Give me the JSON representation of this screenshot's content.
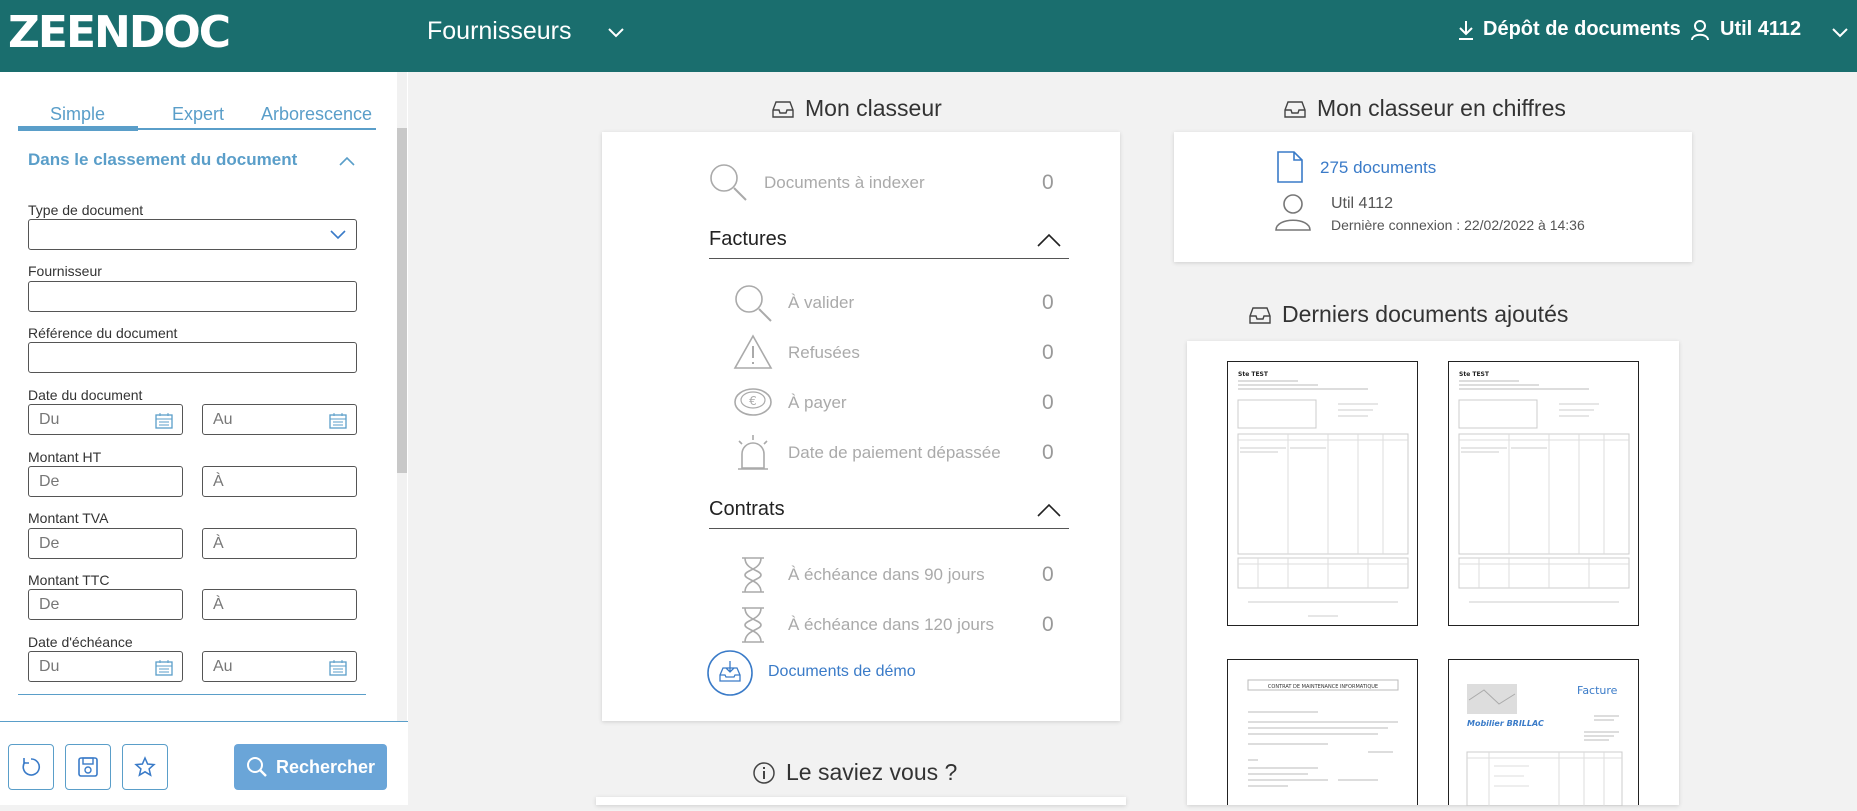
{
  "header": {
    "logo": "ZEENDOC",
    "module": "Fournisseurs",
    "depot_label": "Dépôt de documents",
    "user_label": "Util 4112"
  },
  "sidebar": {
    "tabs": [
      "Simple",
      "Expert",
      "Arborescence"
    ],
    "active_tab": "Simple",
    "section_title": "Dans le classement du document",
    "fields": {
      "type_document": {
        "label": "Type de document",
        "value": ""
      },
      "fournisseur": {
        "label": "Fournisseur",
        "value": ""
      },
      "reference": {
        "label": "Référence du document",
        "value": ""
      },
      "date_document": {
        "label": "Date du document",
        "from_placeholder": "Du",
        "to_placeholder": "Au"
      },
      "montant_ht": {
        "label": "Montant HT",
        "from_placeholder": "De",
        "to_placeholder": "À"
      },
      "montant_tva": {
        "label": "Montant TVA",
        "from_placeholder": "De",
        "to_placeholder": "À"
      },
      "montant_ttc": {
        "label": "Montant TTC",
        "from_placeholder": "De",
        "to_placeholder": "À"
      },
      "date_echeance": {
        "label": "Date d'échéance",
        "from_placeholder": "Du",
        "to_placeholder": "Au"
      }
    },
    "search_label": "Rechercher"
  },
  "classeur": {
    "title": "Mon classeur",
    "a_indexer": {
      "label": "Documents à indexer",
      "count": "0"
    },
    "factures": {
      "title": "Factures",
      "items": [
        {
          "label": "À valider",
          "count": "0",
          "icon": "search-icon"
        },
        {
          "label": "Refusées",
          "count": "0",
          "icon": "warning-icon"
        },
        {
          "label": "À payer",
          "count": "0",
          "icon": "euro-coin-icon"
        },
        {
          "label": "Date de paiement dépassée",
          "count": "0",
          "icon": "alarm-light-icon"
        }
      ]
    },
    "contrats": {
      "title": "Contrats",
      "items": [
        {
          "label": "À échéance dans 90 jours",
          "count": "0",
          "icon": "hourglass-icon"
        },
        {
          "label": "À échéance dans 120 jours",
          "count": "0",
          "icon": "hourglass-icon"
        }
      ]
    },
    "demo_label": "Documents de démo"
  },
  "chiffres": {
    "title": "Mon classeur en chiffres",
    "documents_label": "275 documents",
    "user_name": "Util 4112",
    "last_login": "Dernière connexion : 22/02/2022 à 14:36"
  },
  "derniers": {
    "title": "Derniers documents ajoutés",
    "thumbs": [
      "facture-test-1",
      "facture-test-2",
      "contrat-maintenance",
      "facture-mobilier-brillac"
    ],
    "thumb_texts": {
      "test_title": "Ste TEST",
      "contrat_title": "CONTRAT DE MAINTENANCE INFORMATIQUE",
      "facture_label": "Facture",
      "mobilier_label": "Mobilier BRILLAC"
    }
  },
  "saviez_vous": {
    "title": "Le saviez vous ?"
  },
  "colors": {
    "header_bg": "#1a6e6e",
    "accent": "#5a9ec9",
    "link": "#3a7bc8",
    "search_button": "#6aa5d8"
  }
}
